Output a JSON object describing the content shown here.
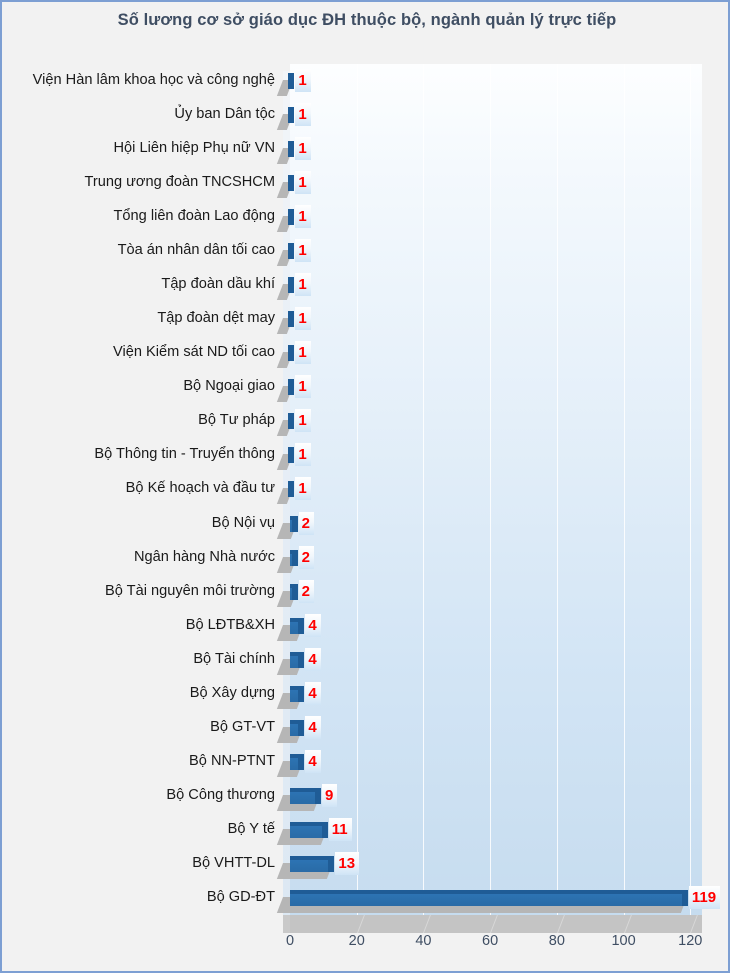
{
  "title": "Số lương cơ sở giáo dục ĐH thuộc bộ, ngành quản lý trực tiếp",
  "colors": {
    "frame_border": "#7d9fd3",
    "frame_background": "#f2f2f2",
    "title_text": "#3f4e63",
    "bar_fill": "#2e75b6",
    "bar_top_edge": "#1f5c96",
    "bar_shadow": "#b6b6b6",
    "data_label_text": "#ff0000",
    "axis_text": "#3f4e63",
    "category_text": "#1a1a1a",
    "plot_top": "#fdfeff",
    "plot_bottom": "#c6dcef"
  },
  "chart_data": {
    "type": "bar",
    "orientation": "horizontal",
    "title": "Số lương cơ sở giáo dục ĐH thuộc bộ, ngành quản lý trực tiếp",
    "xlabel": "",
    "ylabel": "",
    "xlim": [
      0,
      130
    ],
    "xticks": [
      0,
      20,
      40,
      60,
      80,
      100,
      120
    ],
    "tick_labels": [
      "0",
      "20",
      "40",
      "60",
      "80",
      "100",
      "120"
    ],
    "grid": true,
    "legend": false,
    "data_labels": true,
    "categories": [
      "Viện Hàn lâm khoa học và công nghệ",
      "Ủy ban Dân tộc",
      "Hội Liên hiệp Phụ nữ VN",
      "Trung ương đoàn TNCSHCM",
      "Tổng liên đoàn Lao động",
      "Tòa án nhân dân tối cao",
      "Tập đoàn dầu khí",
      "Tập đoàn dệt may",
      "Viện Kiểm sát ND tối cao",
      "Bộ Ngoại giao",
      "Bộ Tư pháp",
      "Bộ Thông tin - Truyển thông",
      "Bộ Kế hoạch và đầu tư",
      "Bộ Nội vụ",
      "Ngân hàng Nhà nước",
      "Bộ Tài nguyên môi trường",
      "Bộ LĐTB&XH",
      "Bộ Tài chính",
      "Bộ Xây dựng",
      "Bộ GT-VT",
      "Bộ NN-PTNT",
      "Bộ Công thương",
      "Bộ Y tế",
      "Bộ VHTT-DL",
      "Bộ GD-ĐT"
    ],
    "values": [
      1,
      1,
      1,
      1,
      1,
      1,
      1,
      1,
      1,
      1,
      1,
      1,
      1,
      2,
      2,
      2,
      4,
      4,
      4,
      4,
      4,
      9,
      11,
      13,
      119
    ],
    "value_labels": [
      "1",
      "1",
      "1",
      "1",
      "1",
      "1",
      "1",
      "1",
      "1",
      "1",
      "1",
      "1",
      "1",
      "2",
      "2",
      "2",
      "4",
      "4",
      "4",
      "4",
      "4",
      "9",
      "11",
      "13",
      "119"
    ]
  }
}
